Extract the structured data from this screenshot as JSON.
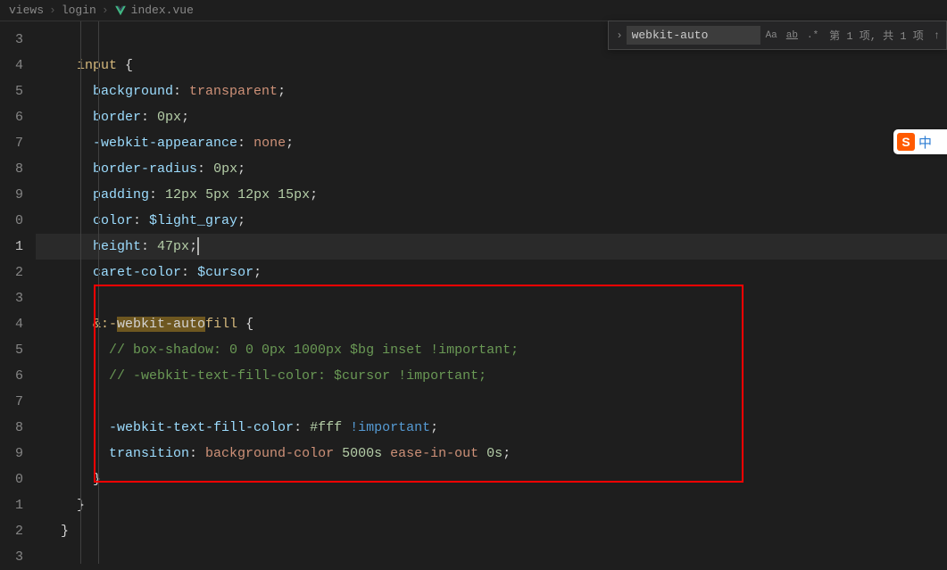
{
  "breadcrumb": {
    "segments": [
      "views",
      "login",
      "index.vue"
    ]
  },
  "find": {
    "value": "webkit-auto",
    "count_text": "第 1 项, 共 1 项",
    "opt_case": "Aa",
    "opt_word": "ab",
    "opt_regex": ".*"
  },
  "ime": {
    "logo": "S",
    "lang": "中"
  },
  "lines": {
    "n3": "3",
    "n4": "4",
    "n5": "5",
    "n6": "6",
    "n7": "7",
    "n8": "8",
    "n9": "9",
    "n10": "0",
    "n11": "1",
    "n12": "2",
    "n13": "3",
    "n14": "4",
    "n15": "5",
    "n16": "6",
    "n17": "7",
    "n18": "8",
    "n19": "9",
    "n20": "0",
    "n21": "1",
    "n22": "2",
    "n23": "3"
  },
  "code": {
    "l4_selector": "input",
    "l4_brace": " {",
    "l5_prop": "background",
    "l5_val": "transparent",
    "l6_prop": "border",
    "l6_val": "0px",
    "l7_prop": "-webkit-appearance",
    "l7_val": "none",
    "l8_prop": "border-radius",
    "l8_val": "0px",
    "l9_prop": "padding",
    "l9_v1": "12px",
    "l9_v2": "5px",
    "l9_v3": "12px",
    "l9_v4": "15px",
    "l10_prop": "color",
    "l10_var": "$light_gray",
    "l11_prop": "height",
    "l11_val": "47px",
    "l12_prop": "caret-color",
    "l12_var": "$cursor",
    "l14_amp": "&",
    "l14_pre": ":-",
    "l14_hl": "webkit-auto",
    "l14_post": "fill",
    "l14_brace": " {",
    "l15_comment": "// box-shadow: 0 0 0px 1000px $bg inset !important;",
    "l16_comment": "// -webkit-text-fill-color: $cursor !important;",
    "l18_prop": "-webkit-text-fill-color",
    "l18_val": "#fff",
    "l18_imp": "!important",
    "l19_prop": "transition",
    "l19_v1": "background-color",
    "l19_v2": "5000s",
    "l19_v3": "ease-in-out",
    "l19_v4": "0s",
    "l20_brace": "}",
    "l21_brace": "}",
    "l22_brace": "}"
  }
}
